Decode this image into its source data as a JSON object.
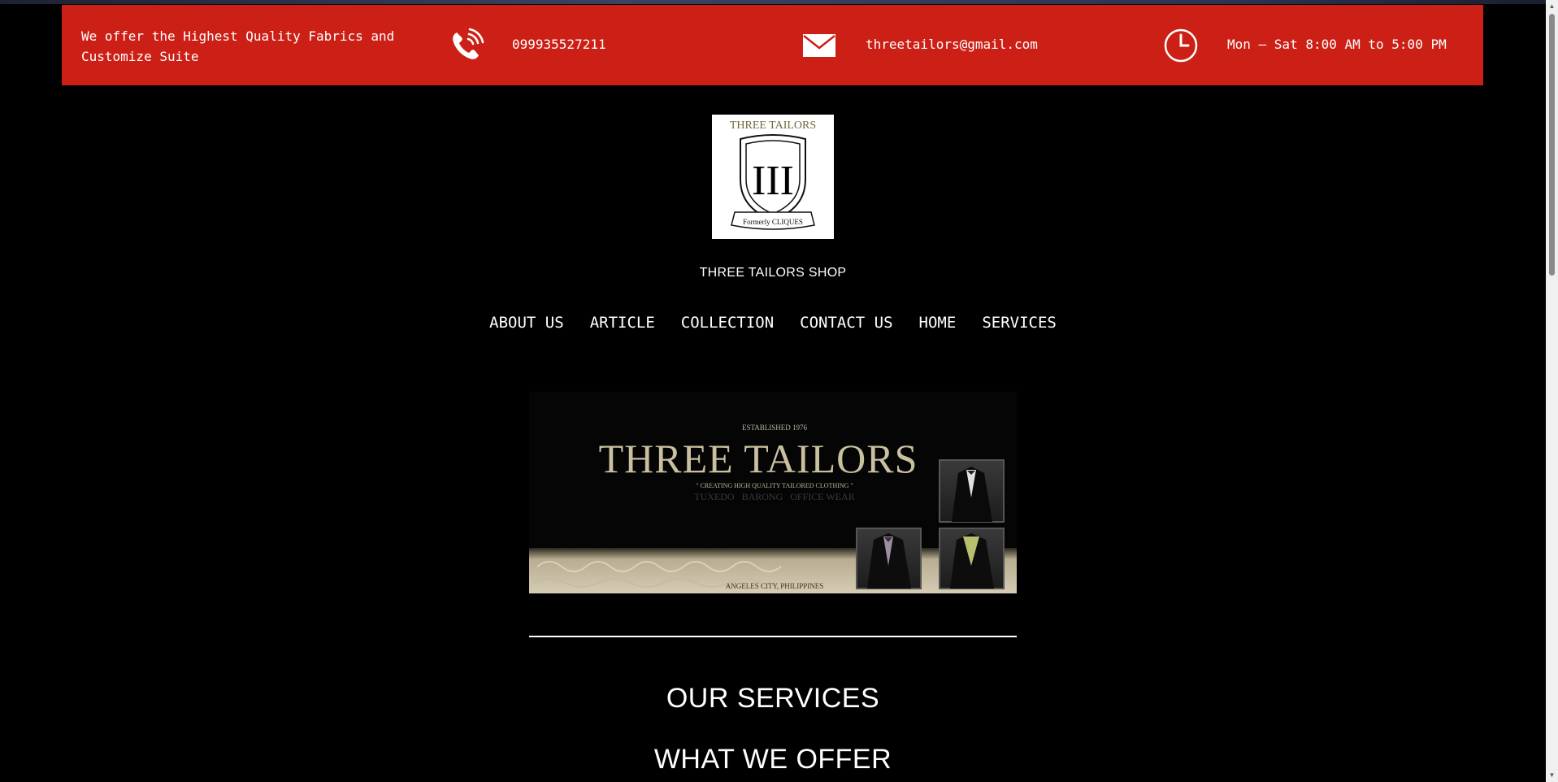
{
  "topbar": {
    "tagline": "We offer the Highest Quality Fabrics and Customize Suite",
    "phone": "099935527211",
    "email": "threetailors@gmail.com",
    "hours": "Mon – Sat 8:00 AM to 5:00 PM",
    "background_color": "#cc2016"
  },
  "logo": {
    "top_text": "THREE TAILORS",
    "crest_text": "III",
    "ribbon_text": "Formerly CLIQUES"
  },
  "shop_name": "THREE TAILORS SHOP",
  "nav": {
    "items": [
      "ABOUT US",
      "ARTICLE",
      "COLLECTION",
      "CONTACT US",
      "HOME",
      "SERVICES"
    ]
  },
  "banner": {
    "established": "ESTABLISHED 1976",
    "title": "THREE TAILORS",
    "tagline": "\" CREATING HIGH QUALITY TAILORED CLOTHING \"",
    "categories": "TUXEDO   BARONG   OFFICE WEAR",
    "location": "ANGELES CITY, PHILIPPINES"
  },
  "sections": {
    "services_title": "OUR SERVICES",
    "offer_title": "WHAT WE OFFER"
  }
}
